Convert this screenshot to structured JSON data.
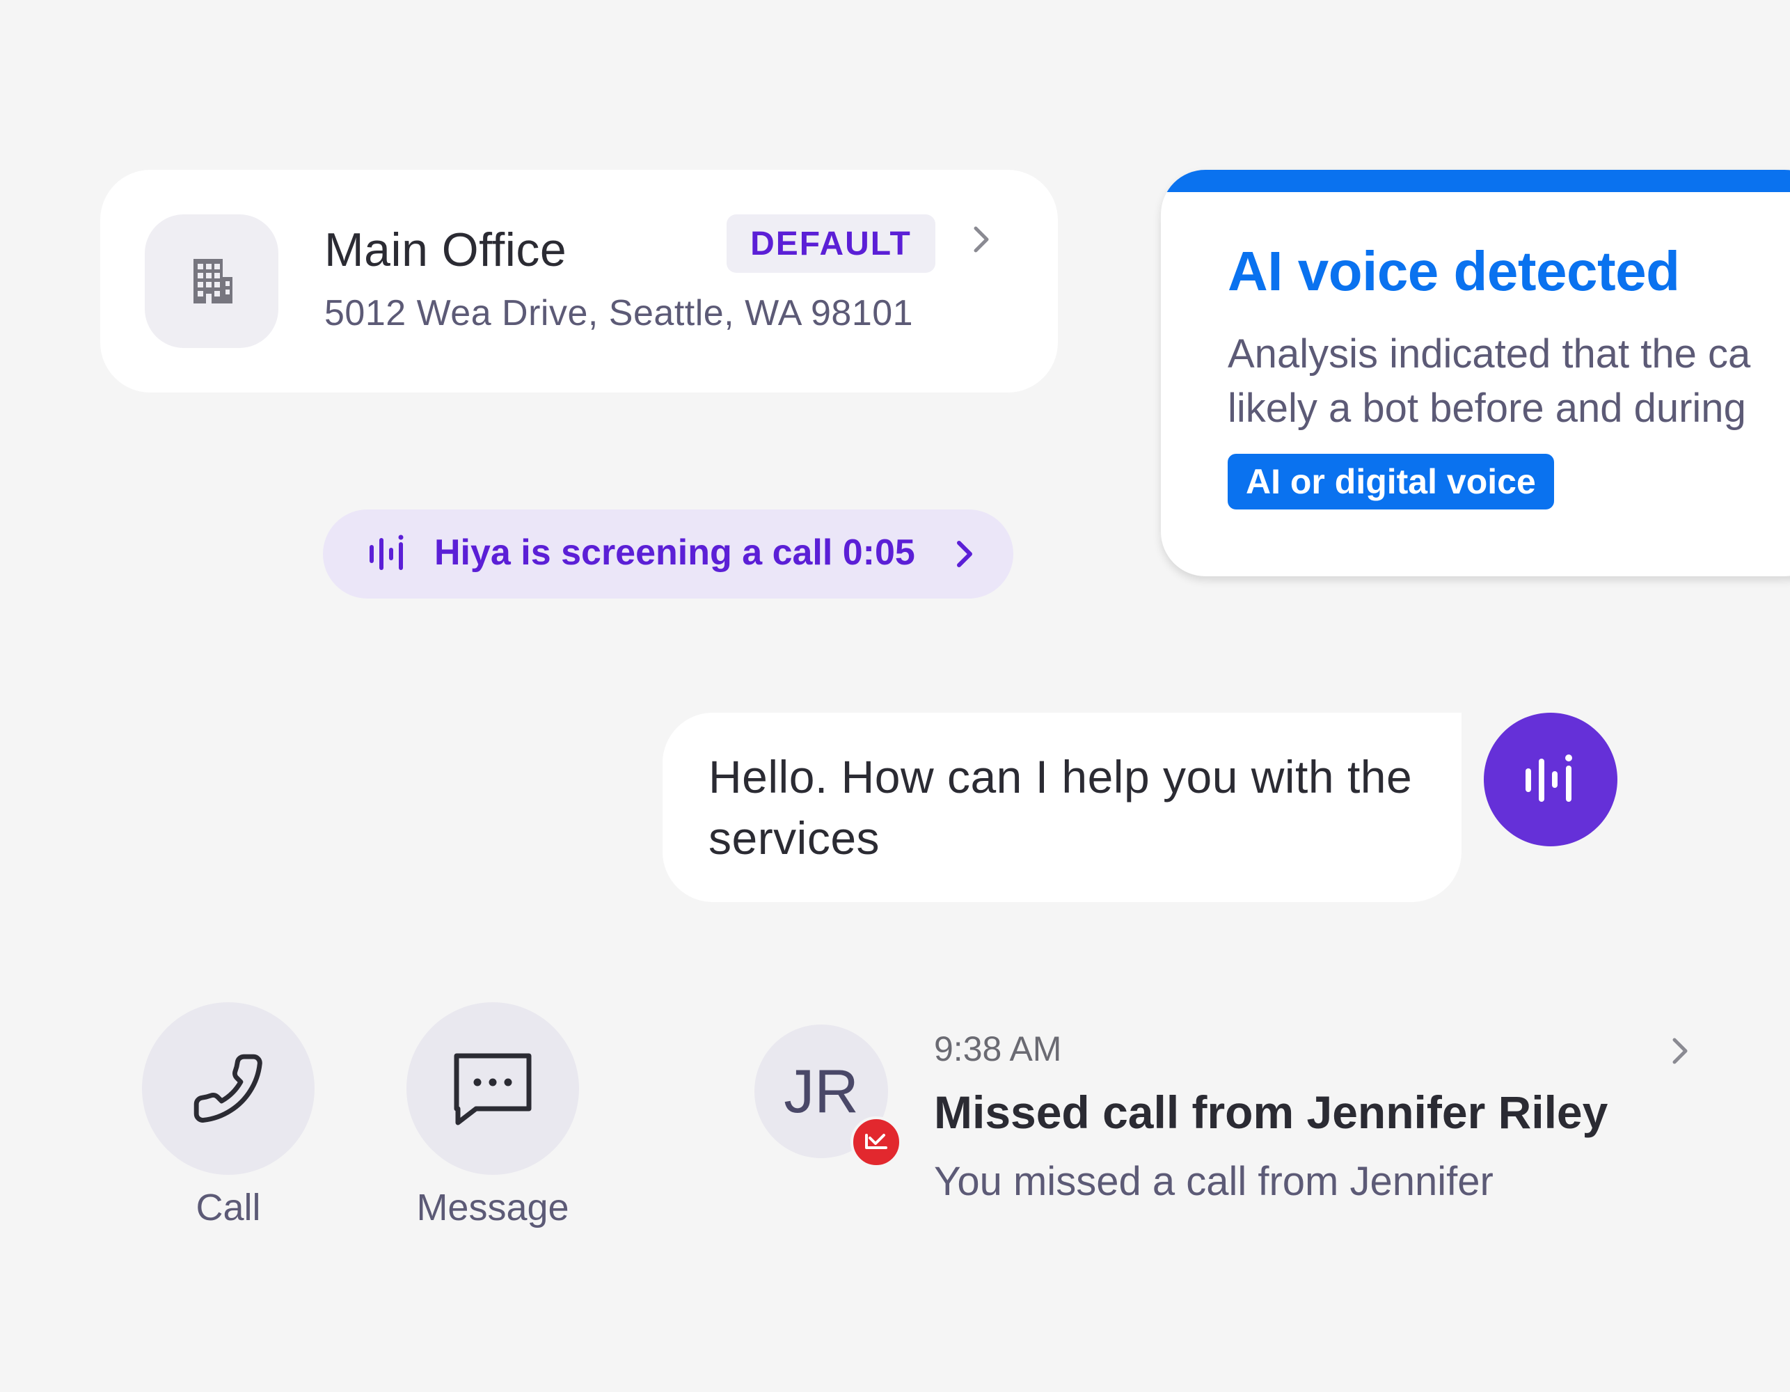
{
  "address_card": {
    "title": "Main Office",
    "address": "5012 Wea Drive, Seattle, WA 98101",
    "badge": "DEFAULT",
    "icon": "building-icon"
  },
  "screening": {
    "text": "Hiya is screening a call 0:05",
    "icon": "waveform-icon"
  },
  "ai_card": {
    "title": "AI voice detected",
    "body_line1": "Analysis indicated that the ca",
    "body_line2": "likely a bot before and during",
    "tag": "AI or digital voice"
  },
  "chat": {
    "message": "Hello. How can I help you with the services",
    "avatar_icon": "waveform-icon"
  },
  "actions": {
    "call_label": "Call",
    "message_label": "Message"
  },
  "notification": {
    "avatar_initials": "JR",
    "time": "9:38 AM",
    "title": "Missed call from Jennifer Riley",
    "subtitle": "You missed a call from Jennifer"
  },
  "colors": {
    "background": "#f5f5f5",
    "purple_accent": "#5b1fd6",
    "assistant_purple": "#6530d8",
    "blue_accent": "#0a72ef",
    "missed_red": "#e2282e"
  }
}
